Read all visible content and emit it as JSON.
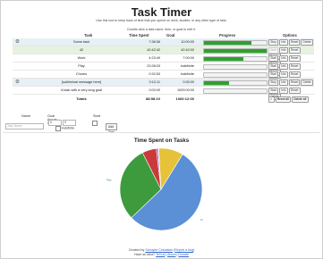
{
  "page": {
    "title": "Task Timer",
    "subtitle": "Use this tool to keep track of time that you spend on work, studies, or any other type of task.",
    "hint": "Double-click a task name, time, or goal to edit it."
  },
  "table": {
    "headers": {
      "task": "Task",
      "spent": "Time Spent",
      "goal": "Goal",
      "progress": "Progress",
      "options": "Options"
    },
    "rows": [
      {
        "gear": true,
        "style": "blue",
        "task": "Some task",
        "spent": "7:38:36",
        "goal": "10:00:00",
        "progress": 0.76,
        "first_btn": "Stop",
        "first_disabled": false
      },
      {
        "gear": false,
        "style": "green",
        "task": "42",
        "spent": "42:42:42",
        "goal": "42:42:00",
        "progress": 1.0,
        "first_btn": "Start",
        "first_disabled": true
      },
      {
        "gear": false,
        "style": "",
        "task": "Work",
        "spent": "4:23:49",
        "goal": "7:00:00",
        "progress": 0.63,
        "first_btn": "Start",
        "first_disabled": false
      },
      {
        "gear": false,
        "style": "",
        "task": "Play",
        "spent": "23:28:03",
        "goal": "Indefinite",
        "progress": 0,
        "first_btn": "Start",
        "first_disabled": false
      },
      {
        "gear": false,
        "style": "",
        "task": "Chores",
        "spent": "0:32:53",
        "goal": "Indefinite",
        "progress": 0,
        "first_btn": "Start",
        "first_disabled": false
      },
      {
        "gear": true,
        "style": "blue",
        "task": "[subliminal message here]",
        "spent": "0:12:11",
        "goal": "0:30:00",
        "progress": 0.4,
        "first_btn": "Stop",
        "first_disabled": false
      },
      {
        "gear": false,
        "style": "",
        "task": "A task with a very long goal",
        "spent": "0:00:00",
        "goal": "1000:00:00",
        "progress": 0,
        "first_btn": "Start",
        "first_disabled": false
      }
    ],
    "row_buttons": {
      "info": "Info",
      "reset": "Reset",
      "delete": "Delete"
    },
    "totals": {
      "label": "Totals",
      "spent": "88:58:10",
      "goal": "1060:12:00",
      "reset_all": "Reset all",
      "delete_all": "Delete all"
    }
  },
  "form": {
    "name_label": "Name",
    "goal_label": "Goal (hours : minutes)",
    "start_label": "Start",
    "name_placeholder": "Task Name",
    "hours_value": "0",
    "minutes_value": "0",
    "indefinite_label": "Indefinite",
    "add_button": "Add Task"
  },
  "chart_data": {
    "type": "pie",
    "title": "Time Spent on Tasks",
    "slices": [
      {
        "label": "42",
        "value": 42.71,
        "color": "#5b8fd6"
      },
      {
        "label": "Play",
        "value": 23.47,
        "color": "#3d9a3d"
      },
      {
        "label": "Work",
        "value": 4.4,
        "color": "#c93a3a"
      },
      {
        "label": "Chores",
        "value": 0.55,
        "color": "#8c56c0"
      },
      {
        "label": "[subliminal message here]",
        "value": 0.2,
        "color": "#e09a2c"
      },
      {
        "label": "Some task",
        "value": 7.64,
        "color": "#e6c23a"
      }
    ]
  },
  "footer": {
    "created_by": "Created by",
    "author": "Schuyler Cebulskie",
    "report": "Report a bug",
    "idea": "Have an idea?",
    "tell_us": "Tell us",
    "about": "About",
    "donate": "Donate"
  }
}
